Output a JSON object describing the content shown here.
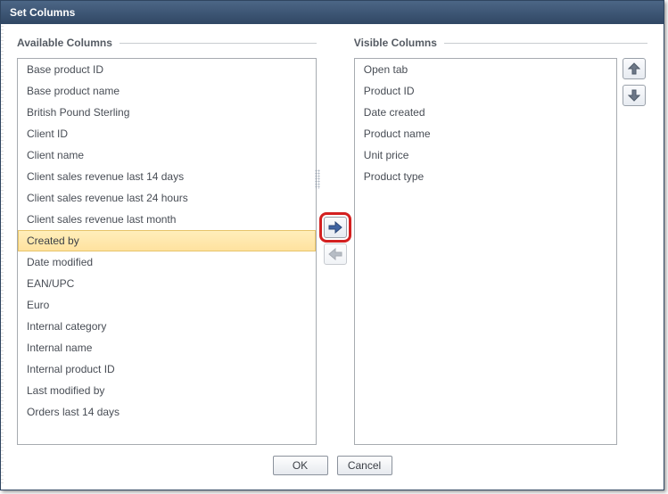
{
  "window": {
    "title": "Set Columns"
  },
  "available": {
    "legend": "Available Columns",
    "items": [
      "Base product ID",
      "Base product name",
      "British Pound Sterling",
      "Client ID",
      "Client name",
      "Client sales revenue last 14 days",
      "Client sales revenue last 24 hours",
      "Client sales revenue last month",
      "Created by",
      "Date modified",
      "EAN/UPC",
      "Euro",
      "Internal category",
      "Internal name",
      "Internal product ID",
      "Last modified by",
      "Orders last 14 days"
    ],
    "selected_index": 8
  },
  "visible": {
    "legend": "Visible Columns",
    "items": [
      "Open tab",
      "Product ID",
      "Date created",
      "Product name",
      "Unit price",
      "Product type"
    ]
  },
  "controls": {
    "add_name": "arrow-right-icon",
    "remove_name": "arrow-left-icon",
    "move_up_name": "arrow-up-icon",
    "move_down_name": "arrow-down-icon"
  },
  "buttons": {
    "ok": "OK",
    "cancel": "Cancel"
  }
}
